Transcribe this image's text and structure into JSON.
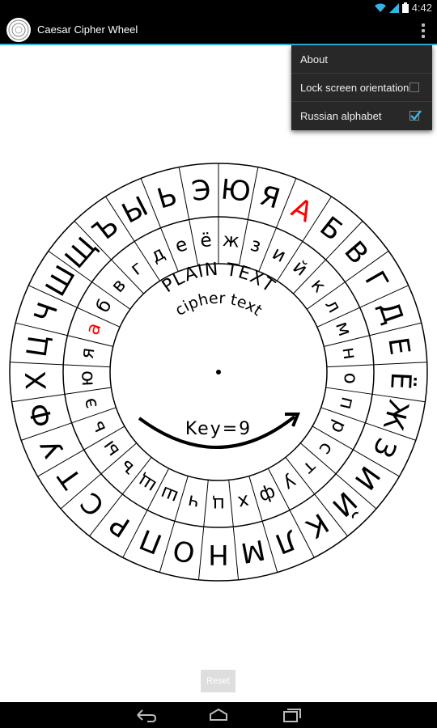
{
  "status": {
    "time": "4:42"
  },
  "app": {
    "title": "Caesar Cipher Wheel"
  },
  "menu": {
    "about": "About",
    "lock_orientation": "Lock screen orientation",
    "lock_orientation_checked": false,
    "russian_alphabet": "Russian alphabet",
    "russian_alphabet_checked": true
  },
  "wheel": {
    "outer_letters": [
      "А",
      "Б",
      "В",
      "Г",
      "Д",
      "Е",
      "Ё",
      "Ж",
      "З",
      "И",
      "Й",
      "К",
      "Л",
      "М",
      "Н",
      "О",
      "П",
      "Р",
      "С",
      "Т",
      "У",
      "Ф",
      "Х",
      "Ц",
      "Ч",
      "Ш",
      "Щ",
      "Ъ",
      "Ы",
      "Ь",
      "Э",
      "Ю",
      "Я"
    ],
    "inner_letters": [
      "а",
      "б",
      "в",
      "г",
      "д",
      "е",
      "ё",
      "ж",
      "з",
      "и",
      "й",
      "к",
      "л",
      "м",
      "н",
      "о",
      "п",
      "р",
      "с",
      "т",
      "у",
      "ф",
      "х",
      "ц",
      "ч",
      "ш",
      "щ",
      "ъ",
      "ы",
      "ь",
      "э",
      "ю",
      "я"
    ],
    "highlight_color": "#ff0000",
    "plain_label": "PLAIN TEXT",
    "cipher_label": "cipher text",
    "key_label": "Key=9",
    "key": 9
  },
  "reset_label": "Reset"
}
